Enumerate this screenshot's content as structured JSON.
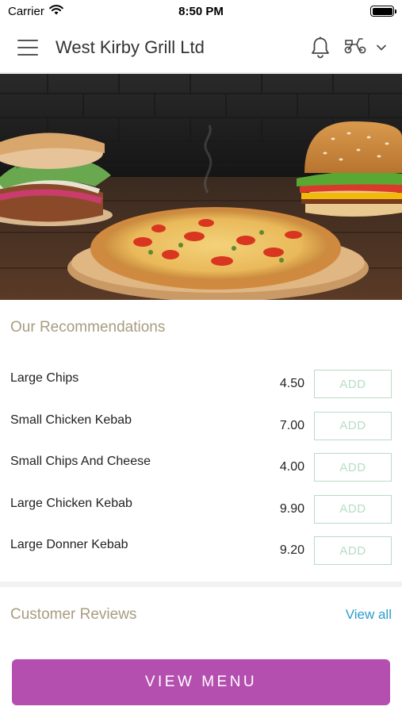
{
  "status_bar": {
    "carrier": "Carrier",
    "time": "8:50 PM"
  },
  "header": {
    "title": "West Kirby Grill Ltd",
    "icons": [
      "menu-icon",
      "bell-icon",
      "scooter-icon",
      "chevron-down-icon"
    ]
  },
  "hero": {
    "image": "food-banner: kebab, pizza, burger on dark wooden table"
  },
  "recommendations": {
    "title": "Our Recommendations",
    "items": [
      {
        "name": "Large Chips",
        "price": "4.50",
        "action": "ADD"
      },
      {
        "name": "Small Chicken Kebab",
        "price": "7.00",
        "action": "ADD"
      },
      {
        "name": "Small Chips And Cheese",
        "price": "4.00",
        "action": "ADD"
      },
      {
        "name": "Large Chicken Kebab",
        "price": "9.90",
        "action": "ADD"
      },
      {
        "name": "Large Donner Kebab",
        "price": "9.20",
        "action": "ADD"
      }
    ]
  },
  "reviews": {
    "title": "Customer Reviews",
    "view_all": "View all"
  },
  "cta": {
    "label": "VIEW MENU"
  },
  "colors": {
    "accent": "#b44fb0",
    "section_title": "#a89c80",
    "link": "#2a9dc9",
    "add_button": "#b7dcc4"
  }
}
